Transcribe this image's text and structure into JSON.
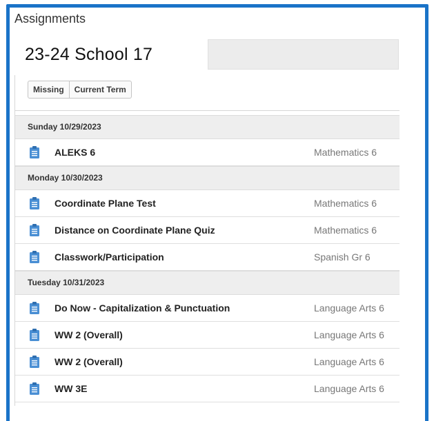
{
  "app": {
    "title": "Assignments",
    "school": "23-24 School 17"
  },
  "filters": [
    {
      "label": "Missing"
    },
    {
      "label": "Current Term"
    }
  ],
  "groups": [
    {
      "date": "Sunday 10/29/2023",
      "items": [
        {
          "name": "ALEKS 6",
          "course": "Mathematics 6"
        }
      ]
    },
    {
      "date": "Monday 10/30/2023",
      "items": [
        {
          "name": "Coordinate Plane Test",
          "course": "Mathematics 6"
        },
        {
          "name": "Distance on Coordinate Plane Quiz",
          "course": "Mathematics 6"
        },
        {
          "name": "Classwork/Participation",
          "course": "Spanish Gr 6"
        }
      ]
    },
    {
      "date": "Tuesday 10/31/2023",
      "items": [
        {
          "name": "Do Now - Capitalization & Punctuation",
          "course": "Language Arts 6"
        },
        {
          "name": "WW 2 (Overall)",
          "course": "Language Arts 6"
        },
        {
          "name": "WW 2 (Overall)",
          "course": "Language Arts 6"
        },
        {
          "name": "WW 3E",
          "course": "Language Arts 6"
        }
      ]
    }
  ],
  "colors": {
    "frame": "#1a73c8",
    "icon": "#4a8fd4",
    "date_row": "#eeeeee"
  },
  "icons": {
    "assignment": "clipboard-icon"
  }
}
